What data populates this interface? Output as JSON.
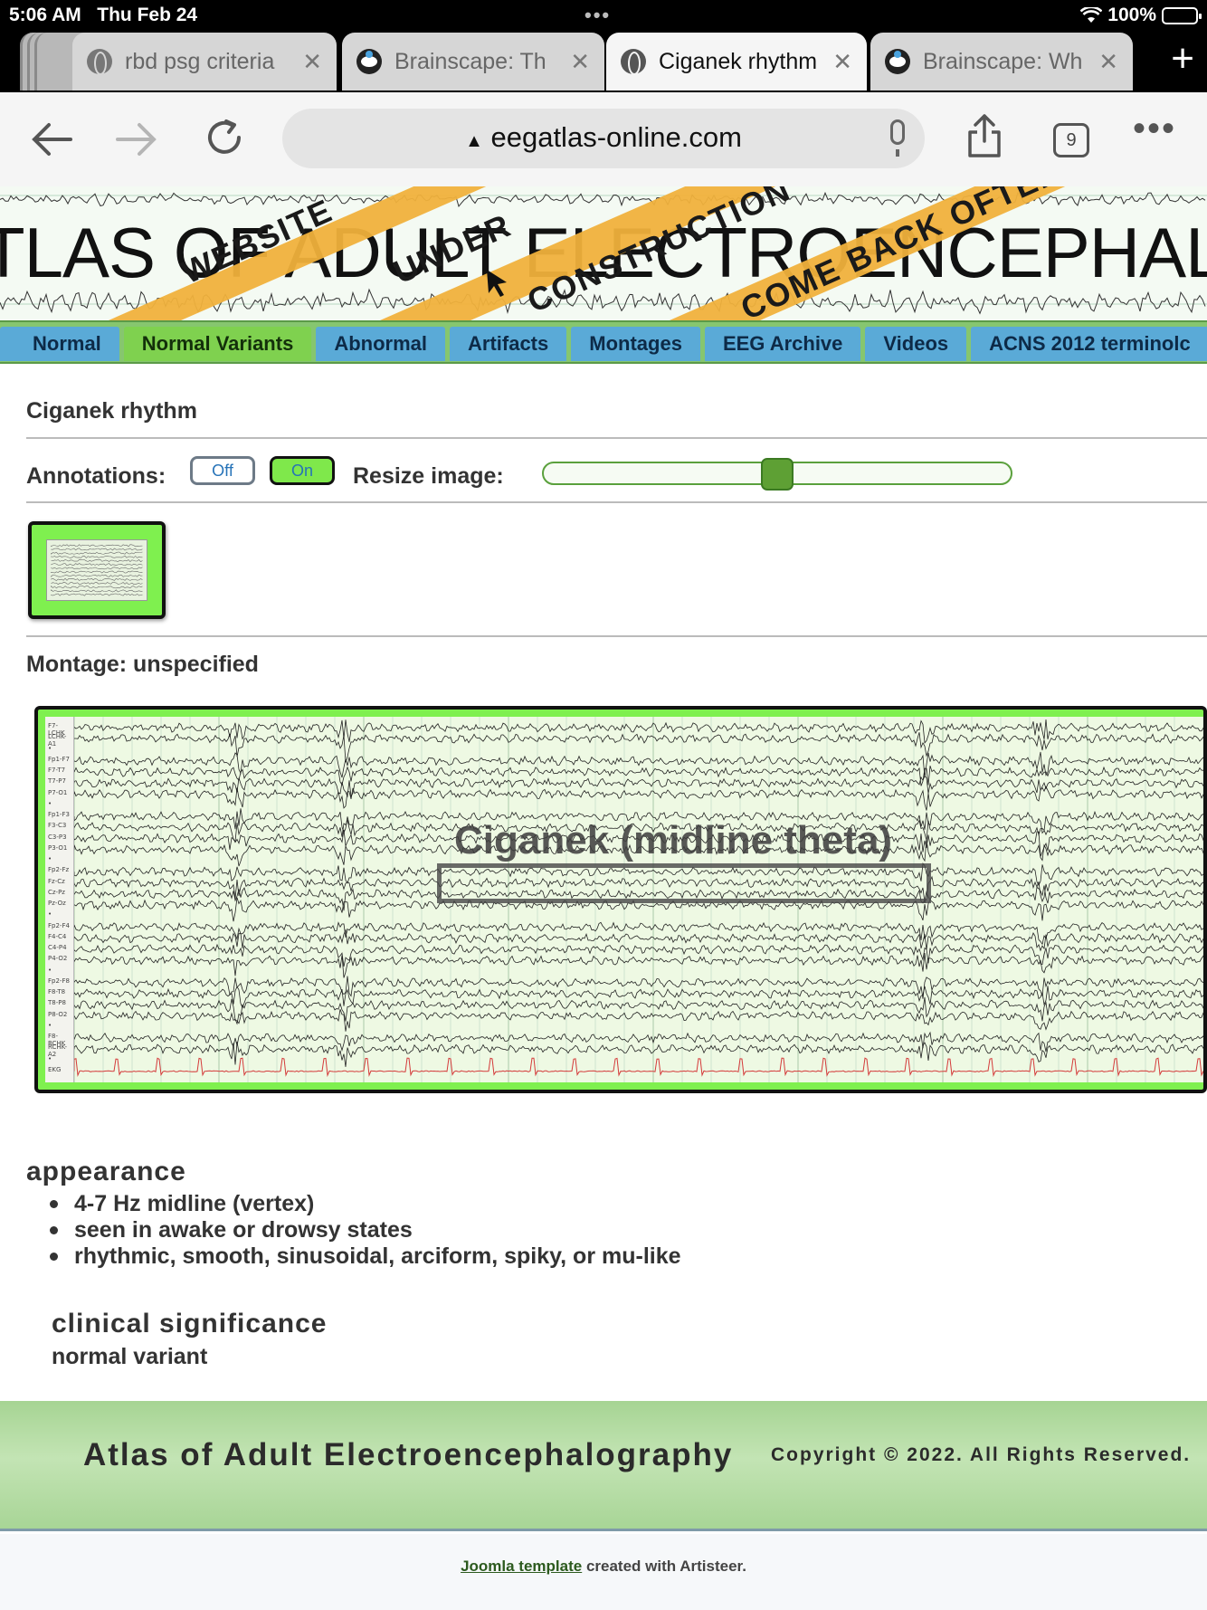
{
  "status_bar": {
    "time": "5:06 AM",
    "date": "Thu Feb 24",
    "battery": "100%"
  },
  "tabs": [
    {
      "label": "rbd psg criteria",
      "icon": "globe-icon",
      "active": false
    },
    {
      "label": "Brainscape: Th",
      "icon": "brainscape-icon",
      "active": false
    },
    {
      "label": "Ciganek rhythm",
      "icon": "globe-icon",
      "active": true
    },
    {
      "label": "Brainscape: Wh",
      "icon": "brainscape-icon",
      "active": false
    }
  ],
  "toolbar": {
    "url": "eegatlas-online.com",
    "tab_count": "9"
  },
  "banner": {
    "title": "TLAS OF ADULT ELECTROENCEPHALO",
    "tape_1a": "WEBSITE",
    "tape_1b": "UNDER",
    "tape_2": "CONSTRUCTION",
    "tape_3": "COME BACK OFTEN!"
  },
  "nav": {
    "items": [
      "Normal",
      "Normal Variants",
      "Abnormal",
      "Artifacts",
      "Montages",
      "EEG Archive",
      "Videos",
      "ACNS 2012 terminolc"
    ],
    "active_index": 1
  },
  "page": {
    "title": "Ciganek rhythm",
    "annotations_label": "Annotations:",
    "toggle_off": "Off",
    "toggle_on": "On",
    "resize_label": "Resize image:",
    "resize_level": 0.5,
    "montage": "Montage: unspecified"
  },
  "eeg": {
    "annotation_title": "Ciganek (midline theta)",
    "channels": [
      "F7-LCHK",
      "LCHK-A1",
      "",
      "Fp1-F7",
      "F7-T7",
      "T7-P7",
      "P7-O1",
      "",
      "Fp1-F3",
      "F3-C3",
      "C3-P3",
      "P3-O1",
      "",
      "Fp2-Fz",
      "Fz-Cz",
      "Cz-Pz",
      "Pz-Oz",
      "",
      "Fp2-F4",
      "F4-C4",
      "C4-P4",
      "P4-O2",
      "",
      "Fp2-F8",
      "F8-T8",
      "T8-P8",
      "P8-O2",
      "",
      "F8-RCHK",
      "RCHK-A2",
      "",
      "EKG"
    ]
  },
  "content": {
    "appearance_title": "appearance",
    "appearance_items": [
      "4-7 Hz midline (vertex)",
      "seen in awake or drowsy states",
      "rhythmic, smooth, sinusoidal, arciform, spiky, or mu-like"
    ],
    "clinical_title": "clinical significance",
    "clinical_text": "normal variant"
  },
  "footer": {
    "title": "Atlas of Adult Electroencephalography",
    "copyright": "Copyright © 2022. All Rights Reserved.",
    "credit_link": "Joomla template",
    "credit_text": " created with Artisteer."
  },
  "colors": {
    "nav_bg": "#86c66f",
    "nav_item": "#5aaad7",
    "nav_active": "#7fd14f",
    "accent_green": "#7ff04f",
    "banner_tape": "#f0b13c"
  }
}
